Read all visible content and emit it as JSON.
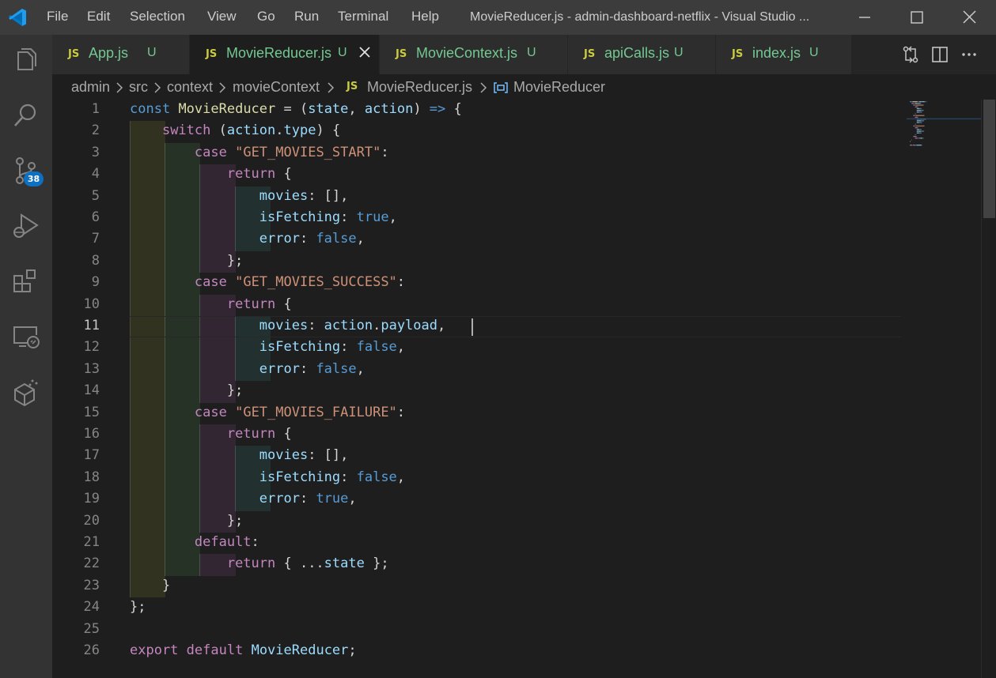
{
  "titlebar": {
    "menu": [
      "File",
      "Edit",
      "Selection",
      "View",
      "Go",
      "Run",
      "Terminal",
      "Help"
    ],
    "title": "MovieReducer.js - admin-dashboard-netflix - Visual Studio ..."
  },
  "activitybar": {
    "icons": [
      "explorer-icon",
      "search-icon",
      "source-control-icon",
      "run-debug-icon",
      "extensions-icon",
      "remote-explorer-icon",
      "3d-box-icon"
    ],
    "source_control_badge": "38"
  },
  "tabs": [
    {
      "badge": "JS",
      "label": "App.js",
      "status": "U",
      "active": false
    },
    {
      "badge": "JS",
      "label": "MovieReducer.js",
      "status": "U",
      "active": true
    },
    {
      "badge": "JS",
      "label": "MovieContext.js",
      "status": "U",
      "active": false
    },
    {
      "badge": "JS",
      "label": "apiCalls.js",
      "status": "U",
      "active": false
    },
    {
      "badge": "JS",
      "label": "index.js",
      "status": "U",
      "active": false
    }
  ],
  "breadcrumb": {
    "parts": [
      "admin",
      "src",
      "context",
      "movieContext"
    ],
    "file_badge": "JS",
    "file": "MovieReducer.js",
    "symbol": "MovieReducer"
  },
  "editor": {
    "current_line": 11,
    "line_numbers": [
      "1",
      "2",
      "3",
      "4",
      "5",
      "6",
      "7",
      "8",
      "9",
      "10",
      "11",
      "12",
      "13",
      "14",
      "15",
      "16",
      "17",
      "18",
      "19",
      "20",
      "21",
      "22",
      "23",
      "24",
      "25",
      "26"
    ],
    "lines": [
      [
        [
          "kw",
          "const"
        ],
        [
          "pun",
          " "
        ],
        [
          "fn",
          "MovieReducer"
        ],
        [
          "pun",
          " = ("
        ],
        [
          "var",
          "state"
        ],
        [
          "pun",
          ", "
        ],
        [
          "var",
          "action"
        ],
        [
          "pun",
          ") "
        ],
        [
          "kw",
          "=>"
        ],
        [
          "pun",
          " {"
        ]
      ],
      [
        [
          "pun",
          "    "
        ],
        [
          "ctl",
          "switch"
        ],
        [
          "pun",
          " ("
        ],
        [
          "var",
          "action"
        ],
        [
          "pun",
          "."
        ],
        [
          "var",
          "type"
        ],
        [
          "pun",
          ") {"
        ]
      ],
      [
        [
          "pun",
          "        "
        ],
        [
          "ctl",
          "case"
        ],
        [
          "pun",
          " "
        ],
        [
          "str",
          "\"GET_MOVIES_START\""
        ],
        [
          "pun",
          ":"
        ]
      ],
      [
        [
          "pun",
          "            "
        ],
        [
          "ctl",
          "return"
        ],
        [
          "pun",
          " {"
        ]
      ],
      [
        [
          "pun",
          "                "
        ],
        [
          "var",
          "movies"
        ],
        [
          "pun",
          ": [],"
        ]
      ],
      [
        [
          "pun",
          "                "
        ],
        [
          "var",
          "isFetching"
        ],
        [
          "pun",
          ": "
        ],
        [
          "kw",
          "true"
        ],
        [
          "pun",
          ","
        ]
      ],
      [
        [
          "pun",
          "                "
        ],
        [
          "var",
          "error"
        ],
        [
          "pun",
          ": "
        ],
        [
          "kw",
          "false"
        ],
        [
          "pun",
          ","
        ]
      ],
      [
        [
          "pun",
          "            };"
        ]
      ],
      [
        [
          "pun",
          "        "
        ],
        [
          "ctl",
          "case"
        ],
        [
          "pun",
          " "
        ],
        [
          "str",
          "\"GET_MOVIES_SUCCESS\""
        ],
        [
          "pun",
          ":"
        ]
      ],
      [
        [
          "pun",
          "            "
        ],
        [
          "ctl",
          "return"
        ],
        [
          "pun",
          " {"
        ]
      ],
      [
        [
          "pun",
          "                "
        ],
        [
          "var",
          "movies"
        ],
        [
          "pun",
          ": "
        ],
        [
          "var",
          "action"
        ],
        [
          "pun",
          "."
        ],
        [
          "var",
          "payload"
        ],
        [
          "pun",
          ","
        ]
      ],
      [
        [
          "pun",
          "                "
        ],
        [
          "var",
          "isFetching"
        ],
        [
          "pun",
          ": "
        ],
        [
          "kw",
          "false"
        ],
        [
          "pun",
          ","
        ]
      ],
      [
        [
          "pun",
          "                "
        ],
        [
          "var",
          "error"
        ],
        [
          "pun",
          ": "
        ],
        [
          "kw",
          "false"
        ],
        [
          "pun",
          ","
        ]
      ],
      [
        [
          "pun",
          "            };"
        ]
      ],
      [
        [
          "pun",
          "        "
        ],
        [
          "ctl",
          "case"
        ],
        [
          "pun",
          " "
        ],
        [
          "str",
          "\"GET_MOVIES_FAILURE\""
        ],
        [
          "pun",
          ":"
        ]
      ],
      [
        [
          "pun",
          "            "
        ],
        [
          "ctl",
          "return"
        ],
        [
          "pun",
          " {"
        ]
      ],
      [
        [
          "pun",
          "                "
        ],
        [
          "var",
          "movies"
        ],
        [
          "pun",
          ": [],"
        ]
      ],
      [
        [
          "pun",
          "                "
        ],
        [
          "var",
          "isFetching"
        ],
        [
          "pun",
          ": "
        ],
        [
          "kw",
          "false"
        ],
        [
          "pun",
          ","
        ]
      ],
      [
        [
          "pun",
          "                "
        ],
        [
          "var",
          "error"
        ],
        [
          "pun",
          ": "
        ],
        [
          "kw",
          "true"
        ],
        [
          "pun",
          ","
        ]
      ],
      [
        [
          "pun",
          "            };"
        ]
      ],
      [
        [
          "pun",
          "        "
        ],
        [
          "ctl",
          "default"
        ],
        [
          "pun",
          ":"
        ]
      ],
      [
        [
          "pun",
          "            "
        ],
        [
          "ctl",
          "return"
        ],
        [
          "pun",
          " { ..."
        ],
        [
          "var",
          "state"
        ],
        [
          "pun",
          " };"
        ]
      ],
      [
        [
          "pun",
          "    }"
        ]
      ],
      [
        [
          "pun",
          "};"
        ]
      ],
      [],
      [
        [
          "ctl",
          "export"
        ],
        [
          "pun",
          " "
        ],
        [
          "ctl",
          "default"
        ],
        [
          "pun",
          " "
        ],
        [
          "var",
          "MovieReducer"
        ],
        [
          "pun",
          ";"
        ]
      ]
    ]
  }
}
